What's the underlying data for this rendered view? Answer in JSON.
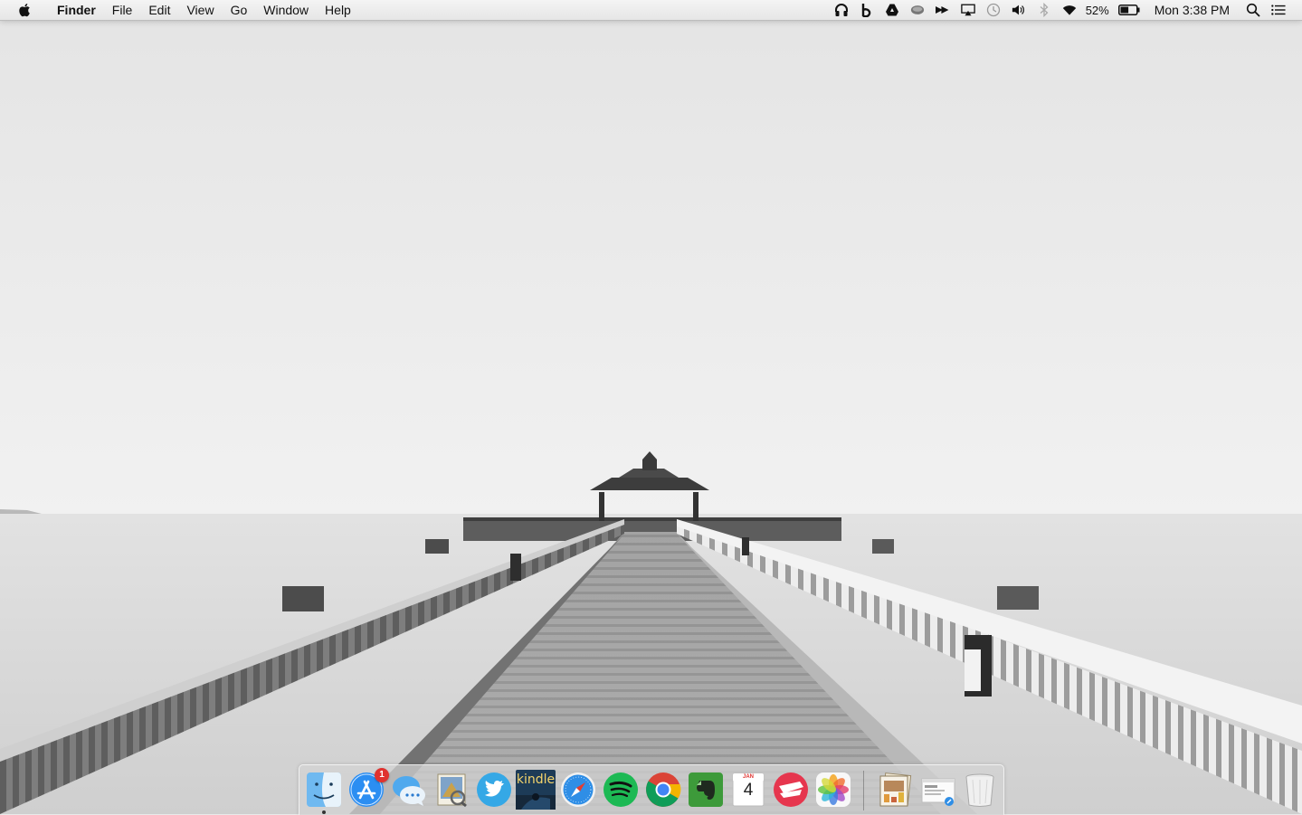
{
  "menubar": {
    "app_name": "Finder",
    "menus": [
      "File",
      "Edit",
      "View",
      "Go",
      "Window",
      "Help"
    ],
    "status_icons": [
      "headphones-icon",
      "bitbar-b-icon",
      "google-drive-icon",
      "skype-icon",
      "fast-forward-icon",
      "airplay-icon",
      "time-machine-icon",
      "volume-icon",
      "bluetooth-icon",
      "wifi-icon"
    ],
    "battery_percent": "52%",
    "battery_level": 0.52,
    "clock": "Mon 3:38 PM"
  },
  "dock": {
    "apps": [
      {
        "name": "Finder",
        "icon": "finder-icon",
        "running": true
      },
      {
        "name": "App Store",
        "icon": "app-store-icon",
        "badge": "1",
        "running": false
      },
      {
        "name": "Messages",
        "icon": "messages-icon",
        "running": false
      },
      {
        "name": "Preview",
        "icon": "preview-icon",
        "running": false
      },
      {
        "name": "Twitter",
        "icon": "twitter-icon",
        "running": false
      },
      {
        "name": "Kindle",
        "icon": "kindle-icon",
        "label": "kindle",
        "running": false
      },
      {
        "name": "Safari",
        "icon": "safari-icon",
        "running": false
      },
      {
        "name": "Spotify",
        "icon": "spotify-icon",
        "running": false
      },
      {
        "name": "Chrome",
        "icon": "chrome-icon",
        "running": false
      },
      {
        "name": "Evernote",
        "icon": "evernote-icon",
        "running": false
      },
      {
        "name": "Calendar",
        "icon": "calendar-icon",
        "month": "JAN",
        "day": "4",
        "running": false
      },
      {
        "name": "Airmail",
        "icon": "airmail-icon",
        "running": false
      },
      {
        "name": "Photos",
        "icon": "photos-icon",
        "running": false
      }
    ],
    "stacks": [
      {
        "name": "Downloads stack",
        "icon": "documents-stack-icon"
      },
      {
        "name": "Screenshots stack",
        "icon": "screenshot-stack-icon"
      },
      {
        "name": "Trash",
        "icon": "trash-icon"
      }
    ]
  },
  "colors": {
    "menubar_bg": "#ececec",
    "badge_red": "#e0322f",
    "wallpaper_sky": "#ececec",
    "wallpaper_sea": "#d8d8d8"
  }
}
